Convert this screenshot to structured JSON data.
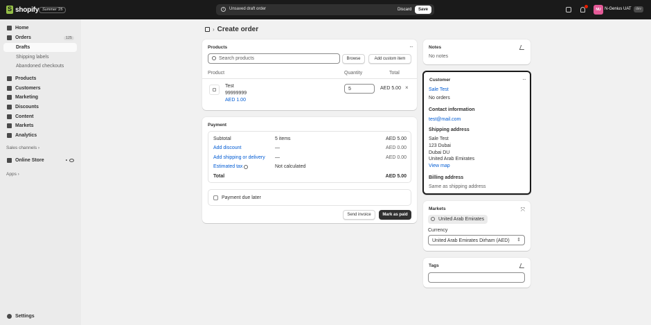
{
  "topbar": {
    "brand": "shopify",
    "edition": "Summer '25",
    "unsaved_message": "Unsaved draft order",
    "discard_label": "Discard",
    "save_label": "Save",
    "notification_count": "1",
    "avatar_initials": "NU",
    "account_name": "N-Genius UAT",
    "account_badge": "dev"
  },
  "sidebar": {
    "home": "Home",
    "orders": "Orders",
    "orders_count": "125",
    "drafts": "Drafts",
    "shipping_labels": "Shipping labels",
    "abandoned_checkouts": "Abandoned checkouts",
    "products": "Products",
    "customers": "Customers",
    "marketing": "Marketing",
    "discounts": "Discounts",
    "content": "Content",
    "markets": "Markets",
    "analytics": "Analytics",
    "sales_channels": "Sales channels",
    "online_store": "Online Store",
    "apps": "Apps",
    "settings": "Settings"
  },
  "page": {
    "title": "Create order"
  },
  "products_card": {
    "title": "Products",
    "search_placeholder": "Search products",
    "browse_label": "Browse",
    "add_custom_label": "Add custom item",
    "col_product": "Product",
    "col_quantity": "Quantity",
    "col_total": "Total",
    "item": {
      "name": "Test",
      "sku": "99999999",
      "price": "AED 1.00",
      "quantity": "5",
      "total": "AED 5.00"
    }
  },
  "payment_card": {
    "title": "Payment",
    "subtotal_label": "Subtotal",
    "subtotal_items": "5 items",
    "subtotal_value": "AED 5.00",
    "discount_label": "Add discount",
    "discount_mid": "—",
    "discount_value": "AED 0.00",
    "shipping_label": "Add shipping or delivery",
    "shipping_mid": "—",
    "shipping_value": "AED 0.00",
    "tax_label": "Estimated tax",
    "tax_mid": "Not calculated",
    "total_label": "Total",
    "total_value": "AED 5.00",
    "due_later_label": "Payment due later",
    "send_invoice_label": "Send invoice",
    "mark_paid_label": "Mark as paid"
  },
  "notes_card": {
    "title": "Notes",
    "text": "No notes"
  },
  "customer_card": {
    "title": "Customer",
    "name": "Sale Test",
    "orders": "No orders",
    "contact_heading": "Contact information",
    "email": "test@mail.com",
    "shipping_heading": "Shipping address",
    "address_line1": "Sale Test",
    "address_line2": "123 Dubai",
    "address_line3": "Dubai DU",
    "address_line4": "United Arab Emirates",
    "view_map": "View map",
    "billing_heading": "Billing address",
    "billing_text": "Same as shipping address"
  },
  "markets_card": {
    "title": "Markets",
    "market_chip": "United Arab Emirates",
    "currency_label": "Currency",
    "currency_value": "United Arab Emirates Dirham (AED)"
  },
  "tags_card": {
    "title": "Tags"
  },
  "colors": {
    "accent": "#005bd3",
    "topbar": "#1a1a1a",
    "primary_button": "#303030"
  }
}
